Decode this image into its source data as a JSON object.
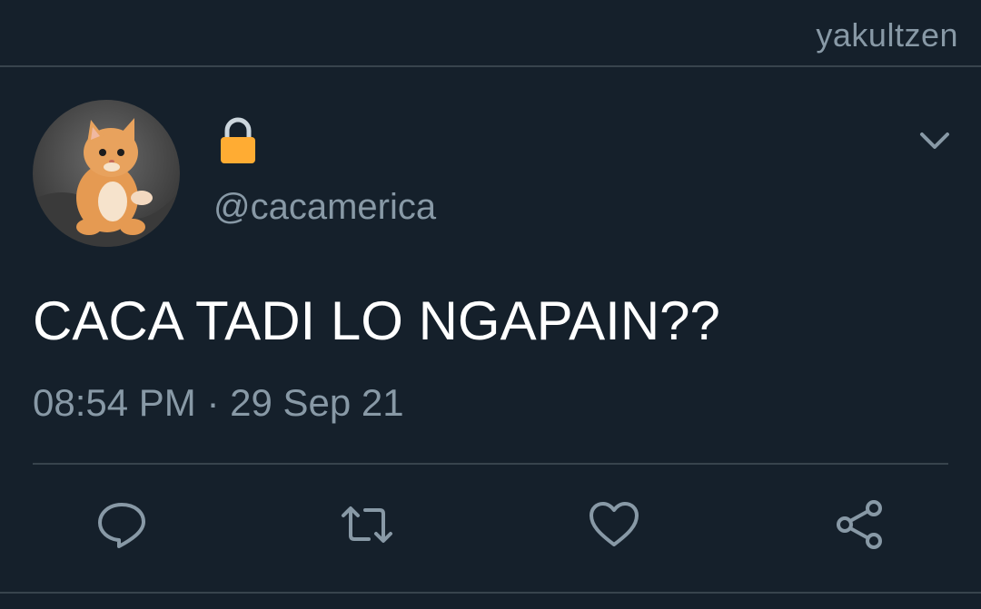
{
  "watermark": "yakultzen",
  "tweet": {
    "display_name_icon": "lock-icon",
    "handle": "@cacamerica",
    "text": "CACA TADI LO NGAPAIN??",
    "time": "08:54 PM",
    "separator": "·",
    "date": "29 Sep 21"
  },
  "actions": [
    {
      "icon": "reply-icon"
    },
    {
      "icon": "retweet-icon"
    },
    {
      "icon": "like-icon"
    },
    {
      "icon": "share-icon"
    }
  ],
  "colors": {
    "background": "#15202b",
    "text": "#ffffff",
    "secondary": "#8899a6",
    "divider": "#38444d",
    "lock": "#ffac33"
  }
}
